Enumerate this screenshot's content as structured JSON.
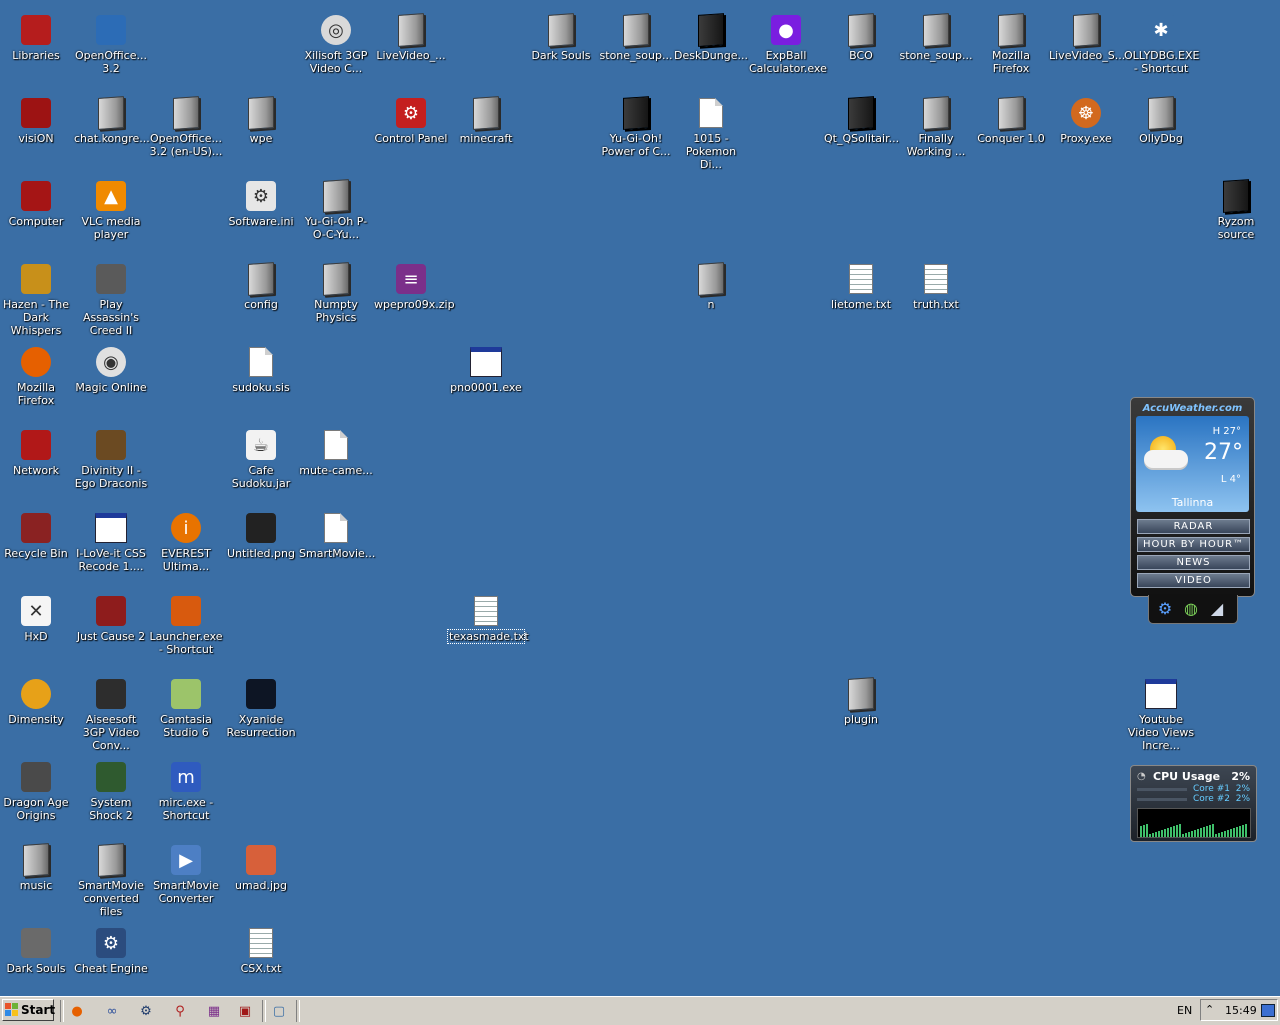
{
  "desktop": {
    "icons": [
      {
        "label": "Libraries",
        "kind": "app",
        "color": "#b51d1d",
        "glyph": ""
      },
      {
        "label": "OpenOffice... 3.2",
        "kind": "app",
        "color": "#2c6cb6",
        "glyph": ""
      },
      {
        "label": "Xilisoft 3GP Video C...",
        "kind": "round",
        "color": "#d9d9d9",
        "glyph": "◎"
      },
      {
        "label": "LiveVideo_...",
        "kind": "folder",
        "color": "",
        "glyph": ""
      },
      {
        "label": "Dark Souls",
        "kind": "folder",
        "color": "",
        "glyph": ""
      },
      {
        "label": "stone_soup...",
        "kind": "folder",
        "color": "",
        "glyph": ""
      },
      {
        "label": "DeskDunge...",
        "kind": "darkfolder",
        "color": "",
        "glyph": ""
      },
      {
        "label": "ExpBall Calculator.exe",
        "kind": "app",
        "color": "#7a1ee0",
        "glyph": "●"
      },
      {
        "label": "BCO",
        "kind": "folder",
        "color": "",
        "glyph": ""
      },
      {
        "label": "stone_soup...",
        "kind": "folder",
        "color": "",
        "glyph": ""
      },
      {
        "label": "Mozilla Firefox",
        "kind": "folder",
        "color": "",
        "glyph": ""
      },
      {
        "label": "LiveVideo_S...",
        "kind": "folder",
        "color": "",
        "glyph": ""
      },
      {
        "label": "OLLYDBG.EXE - Shortcut",
        "kind": "app",
        "color": "#3a6ea5",
        "glyph": "✱"
      },
      {
        "label": "visiON",
        "kind": "app",
        "color": "#9d1313",
        "glyph": ""
      },
      {
        "label": "chat.kongre...",
        "kind": "folder",
        "color": "",
        "glyph": ""
      },
      {
        "label": "OpenOffice... 3.2 (en-US)...",
        "kind": "folder",
        "color": "",
        "glyph": ""
      },
      {
        "label": "wpe",
        "kind": "folder",
        "color": "",
        "glyph": ""
      },
      {
        "label": "Control Panel",
        "kind": "app",
        "color": "#c41f1f",
        "glyph": "⚙"
      },
      {
        "label": "minecraft",
        "kind": "folder",
        "color": "",
        "glyph": ""
      },
      {
        "label": "Yu-Gi-Oh! Power of C...",
        "kind": "darkfolder",
        "color": "",
        "glyph": ""
      },
      {
        "label": "1015 - Pokemon Di...",
        "kind": "file",
        "color": "",
        "glyph": ""
      },
      {
        "label": "Qt_QSolitair...",
        "kind": "darkfolder",
        "color": "",
        "glyph": ""
      },
      {
        "label": "Finally Working ...",
        "kind": "folder",
        "color": "",
        "glyph": ""
      },
      {
        "label": "Conquer 1.0",
        "kind": "folder",
        "color": "",
        "glyph": ""
      },
      {
        "label": "Proxy.exe",
        "kind": "round",
        "color": "#d2691e",
        "glyph": "☸"
      },
      {
        "label": "OllyDbg",
        "kind": "folder",
        "color": "",
        "glyph": ""
      },
      {
        "label": "Computer",
        "kind": "app",
        "color": "#a51515",
        "glyph": ""
      },
      {
        "label": "VLC media player",
        "kind": "app",
        "color": "#f08a00",
        "glyph": "▲"
      },
      {
        "label": "Software.ini",
        "kind": "app",
        "color": "#e6e6e6",
        "glyph": "⚙"
      },
      {
        "label": "Yu-Gi-Oh P-O-C-Yu...",
        "kind": "folder",
        "color": "",
        "glyph": ""
      },
      {
        "label": "Ryzom source",
        "kind": "darkfolder",
        "color": "",
        "glyph": ""
      },
      {
        "label": "Hazen - The Dark Whispers",
        "kind": "app",
        "color": "#c8901a",
        "glyph": ""
      },
      {
        "label": "Play Assassin's Creed II",
        "kind": "app",
        "color": "#5a5a5a",
        "glyph": ""
      },
      {
        "label": "config",
        "kind": "folder",
        "color": "",
        "glyph": ""
      },
      {
        "label": "Numpty Physics",
        "kind": "folder",
        "color": "",
        "glyph": ""
      },
      {
        "label": "wpepro09x.zip",
        "kind": "app",
        "color": "#7b2f8a",
        "glyph": "≡"
      },
      {
        "label": "n",
        "kind": "folder",
        "color": "",
        "glyph": ""
      },
      {
        "label": "lietome.txt",
        "kind": "txt",
        "color": "",
        "glyph": ""
      },
      {
        "label": "truth.txt",
        "kind": "txt",
        "color": "",
        "glyph": ""
      },
      {
        "label": "Mozilla Firefox",
        "kind": "round",
        "color": "#e66000",
        "glyph": ""
      },
      {
        "label": "Magic Online",
        "kind": "round",
        "color": "#e0e0e0",
        "glyph": "◉"
      },
      {
        "label": "sudoku.sis",
        "kind": "file",
        "color": "",
        "glyph": ""
      },
      {
        "label": "pno0001.exe",
        "kind": "win",
        "color": "",
        "glyph": ""
      },
      {
        "label": "Network",
        "kind": "app",
        "color": "#b11818",
        "glyph": ""
      },
      {
        "label": "Divinity II - Ego Draconis",
        "kind": "app",
        "color": "#6b4a22",
        "glyph": ""
      },
      {
        "label": "Cafe Sudoku.jar",
        "kind": "app",
        "color": "#f2f2f2",
        "glyph": "☕"
      },
      {
        "label": "mute-came...",
        "kind": "file",
        "color": "",
        "glyph": ""
      },
      {
        "label": "Recycle Bin",
        "kind": "app",
        "color": "#8a2222",
        "glyph": ""
      },
      {
        "label": "I-LoVe-it CSS Recode 1....",
        "kind": "win",
        "color": "",
        "glyph": ""
      },
      {
        "label": "EVEREST Ultima...",
        "kind": "round",
        "color": "#e87300",
        "glyph": "i"
      },
      {
        "label": "Untitled.png",
        "kind": "app",
        "color": "#222222",
        "glyph": ""
      },
      {
        "label": "SmartMovie...",
        "kind": "file",
        "color": "",
        "glyph": ""
      },
      {
        "label": "HxD",
        "kind": "app",
        "color": "#f5f5f5",
        "glyph": "✕"
      },
      {
        "label": "Just Cause 2",
        "kind": "app",
        "color": "#8e1c1c",
        "glyph": ""
      },
      {
        "label": "Launcher.exe - Shortcut",
        "kind": "app",
        "color": "#d85a0e",
        "glyph": ""
      },
      {
        "label": "texasmade.txt",
        "kind": "txt",
        "color": "",
        "glyph": ""
      },
      {
        "label": "Dimensity",
        "kind": "round",
        "color": "#e7a118",
        "glyph": ""
      },
      {
        "label": "Aiseesoft 3GP Video Conv...",
        "kind": "app",
        "color": "#2d2d2d",
        "glyph": ""
      },
      {
        "label": "Camtasia Studio 6",
        "kind": "app",
        "color": "#9cc46a",
        "glyph": ""
      },
      {
        "label": "Xyanide Resurrection",
        "kind": "app",
        "color": "#0d1524",
        "glyph": ""
      },
      {
        "label": "plugin",
        "kind": "folder",
        "color": "",
        "glyph": ""
      },
      {
        "label": "Youtube Video Views Incre...",
        "kind": "win",
        "color": "",
        "glyph": ""
      },
      {
        "label": "Dragon Age Origins",
        "kind": "app",
        "color": "#4a4a4a",
        "glyph": ""
      },
      {
        "label": "System Shock 2",
        "kind": "app",
        "color": "#2f5a2f",
        "glyph": ""
      },
      {
        "label": "mirc.exe - Shortcut",
        "kind": "app",
        "color": "#2f5bbf",
        "glyph": "m"
      },
      {
        "label": "music",
        "kind": "folder",
        "color": "",
        "glyph": ""
      },
      {
        "label": "SmartMovie converted files",
        "kind": "folder",
        "color": "",
        "glyph": ""
      },
      {
        "label": "SmartMovie Converter",
        "kind": "app",
        "color": "#4d7fc4",
        "glyph": "▶"
      },
      {
        "label": "umad.jpg",
        "kind": "app",
        "color": "#d7603a",
        "glyph": ""
      },
      {
        "label": "Dark Souls",
        "kind": "app",
        "color": "#6a6a6a",
        "glyph": ""
      },
      {
        "label": "Cheat Engine",
        "kind": "app",
        "color": "#2b4c7e",
        "glyph": "⚙"
      },
      {
        "label": "CSX.txt",
        "kind": "txt",
        "color": "",
        "glyph": ""
      }
    ]
  },
  "weather_gadget": {
    "brand": "AccuWeather.com",
    "high": "H 27°",
    "current": "27°",
    "low": "L 4°",
    "city": "Tallinna",
    "buttons": [
      "RADAR",
      "HOUR BY HOUR™",
      "NEWS",
      "VIDEO"
    ],
    "tool_icons": [
      "gear-icon",
      "globe-icon",
      "flag-icon"
    ]
  },
  "cpu_gadget": {
    "title": "CPU Usage",
    "total_percent": "2%",
    "cores": [
      {
        "label": "Core #1",
        "percent": "2%"
      },
      {
        "label": "Core #2",
        "percent": "2%"
      }
    ]
  },
  "taskbar": {
    "start_label": "Start",
    "quick_launch_icons": [
      "firefox-icon",
      "infinity-icon",
      "cheat-engine-icon",
      "magnifier-icon",
      "winrar-icon",
      "terminal-icon",
      "window-icon"
    ],
    "language": "EN",
    "clock": "15:49"
  }
}
